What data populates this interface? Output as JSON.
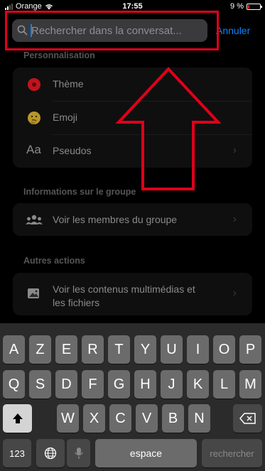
{
  "status_bar": {
    "carrier": "Orange",
    "time": "17:55",
    "battery": "9 %",
    "battery_level": 0.09
  },
  "search": {
    "placeholder": "Rechercher dans la conversat...",
    "cancel_label": "Annuler"
  },
  "colors": {
    "accent": "#0a84ff",
    "highlight": "#e0001a",
    "theme_dot": "#c0141c"
  },
  "sections": [
    {
      "title": "Personnalisation",
      "items": [
        {
          "label": "Thème",
          "icon": "theme-color-icon"
        },
        {
          "label": "Emoji",
          "icon": "thinking-emoji-icon"
        },
        {
          "label": "Pseudos",
          "icon": "text-aa-icon",
          "icon_text": "Aa"
        }
      ]
    },
    {
      "title": "Informations sur le groupe",
      "items": [
        {
          "label": "Voir les membres du groupe",
          "icon": "people-icon"
        }
      ]
    },
    {
      "title": "Autres actions",
      "items": [
        {
          "label_line1": "Voir les contenus multimédias et",
          "label_line2": "les fichiers",
          "icon": "image-icon"
        }
      ]
    }
  ],
  "keyboard": {
    "row1": [
      "A",
      "Z",
      "E",
      "R",
      "T",
      "Y",
      "U",
      "I",
      "O",
      "P"
    ],
    "row2": [
      "Q",
      "S",
      "D",
      "F",
      "G",
      "H",
      "J",
      "K",
      "L",
      "M"
    ],
    "row3": [
      "W",
      "X",
      "C",
      "V",
      "B",
      "N"
    ],
    "numbers_label": "123",
    "space_label": "espace",
    "search_label": "rechercher"
  }
}
